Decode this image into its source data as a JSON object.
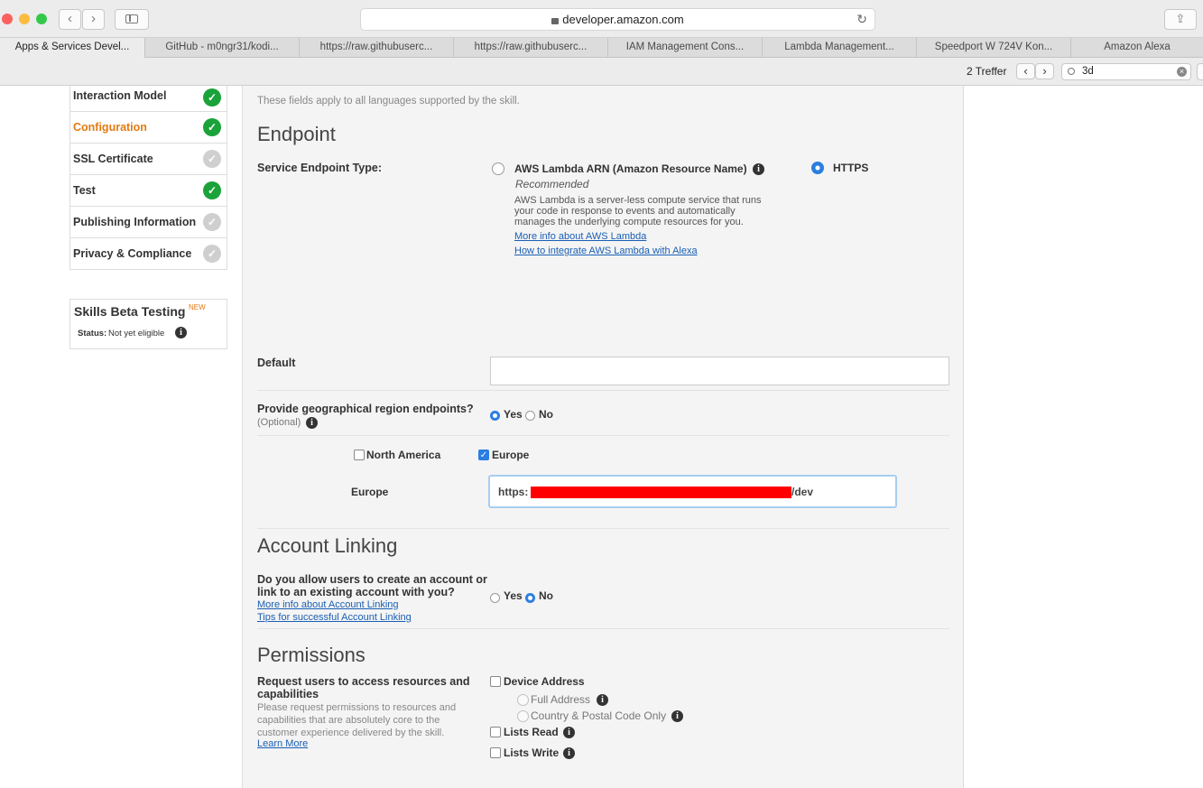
{
  "browser": {
    "url": "developer.amazon.com",
    "tabs": [
      {
        "label": "Apps & Services Devel..."
      },
      {
        "label": "GitHub - m0ngr31/kodi..."
      },
      {
        "label": "https://raw.githubuserc..."
      },
      {
        "label": "https://raw.githubuserc..."
      },
      {
        "label": "IAM Management Cons..."
      },
      {
        "label": "Lambda Management..."
      },
      {
        "label": "Speedport W 724V Kon..."
      },
      {
        "label": "Amazon Alexa"
      }
    ],
    "find": {
      "result_count": "2 Treffer",
      "query": "3d"
    }
  },
  "sidebar": {
    "items": [
      {
        "label": "Interaction Model",
        "status": "complete"
      },
      {
        "label": "Configuration",
        "status": "complete"
      },
      {
        "label": "SSL Certificate",
        "status": "incomplete"
      },
      {
        "label": "Test",
        "status": "complete"
      },
      {
        "label": "Publishing Information",
        "status": "incomplete"
      },
      {
        "label": "Privacy & Compliance",
        "status": "incomplete"
      }
    ],
    "beta": {
      "title": "Skills Beta Testing",
      "badge": "NEW",
      "status_label": "Status:",
      "status_value": "Not yet eligible"
    }
  },
  "form": {
    "intro": "These fields apply to all languages supported by the skill.",
    "endpoint": {
      "heading": "Endpoint",
      "type_label": "Service Endpoint Type:",
      "lambda_option": "AWS Lambda ARN (Amazon Resource Name)",
      "lambda_recommended": "Recommended",
      "lambda_desc_1": "AWS Lambda is a server-less compute service that runs",
      "lambda_desc_2": "your code in response to events and automatically",
      "lambda_desc_3": "manages the underlying compute resources for you.",
      "lambda_link_1": "More info about AWS Lambda",
      "lambda_link_2": "How to integrate AWS Lambda with Alexa",
      "https_option": "HTTPS",
      "selected": "HTTPS",
      "default_label": "Default",
      "default_value": "",
      "geo_label": "Provide geographical region endpoints?",
      "geo_optional": "(Optional)",
      "yes": "Yes",
      "no": "No",
      "geo_selected": "Yes",
      "north_america": "North America",
      "north_america_checked": false,
      "europe": "Europe",
      "europe_checked": true,
      "europe_label": "Europe",
      "europe_prefix": "https:",
      "europe_suffix": "/dev"
    },
    "account_linking": {
      "heading": "Account Linking",
      "question_1": "Do you allow users to create an account or",
      "question_2": "link to an existing account with you?",
      "link_1": "More info about Account Linking",
      "link_2": "Tips for successful Account Linking",
      "yes": "Yes",
      "no": "No",
      "selected": "No"
    },
    "permissions": {
      "heading": "Permissions",
      "request_label_1": "Request users to access resources and",
      "request_label_2": "capabilities",
      "desc_1": "Please request permissions to resources and",
      "desc_2": "capabilities that are absolutely core to the",
      "desc_3": "customer experience delivered by the skill.",
      "learn_more": "Learn More",
      "device_address": "Device Address",
      "full_address": "Full Address",
      "country_postal": "Country & Postal Code Only",
      "lists_read": "Lists Read",
      "lists_write": "Lists Write"
    }
  }
}
